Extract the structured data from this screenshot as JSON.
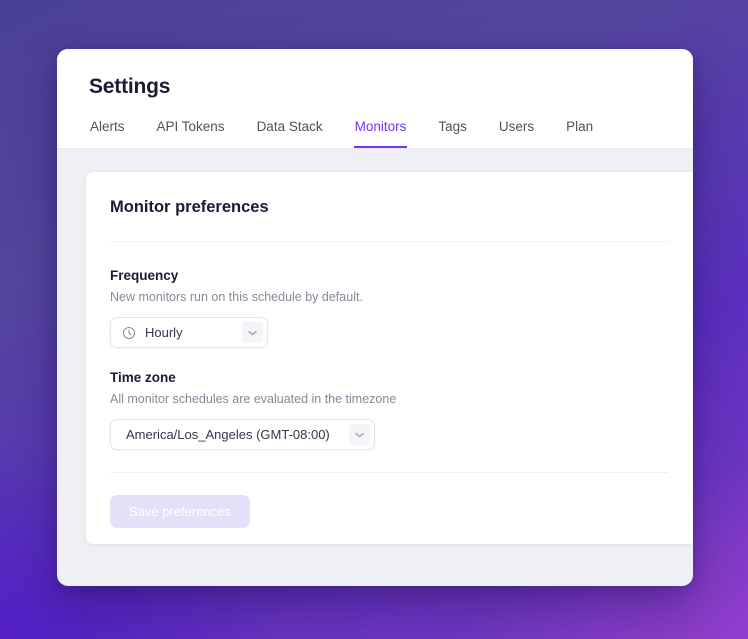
{
  "window": {
    "header": {
      "title": "Settings",
      "tabs": [
        {
          "label": "Alerts",
          "active": false
        },
        {
          "label": "API Tokens",
          "active": false
        },
        {
          "label": "Data Stack",
          "active": false
        },
        {
          "label": "Monitors",
          "active": true
        },
        {
          "label": "Tags",
          "active": false
        },
        {
          "label": "Users",
          "active": false
        },
        {
          "label": "Plan",
          "active": false
        }
      ]
    },
    "card": {
      "title": "Monitor preferences",
      "frequency": {
        "label": "Frequency",
        "help": "New monitors run on this schedule by default.",
        "icon": "clock-icon",
        "value": "Hourly",
        "chevron": "chevron-down-icon"
      },
      "timezone": {
        "label": "Time zone",
        "help": "All monitor schedules are evaluated in the timezone",
        "value": "America/Los_Angeles (GMT-08:00)",
        "chevron": "chevron-down-icon"
      },
      "save_label": "Save preferences"
    }
  },
  "colors": {
    "accent": "#7b2ff7",
    "title": "#1b1b38",
    "help_text": "#858a99",
    "save_disabled_bg": "#e4e0f7"
  }
}
